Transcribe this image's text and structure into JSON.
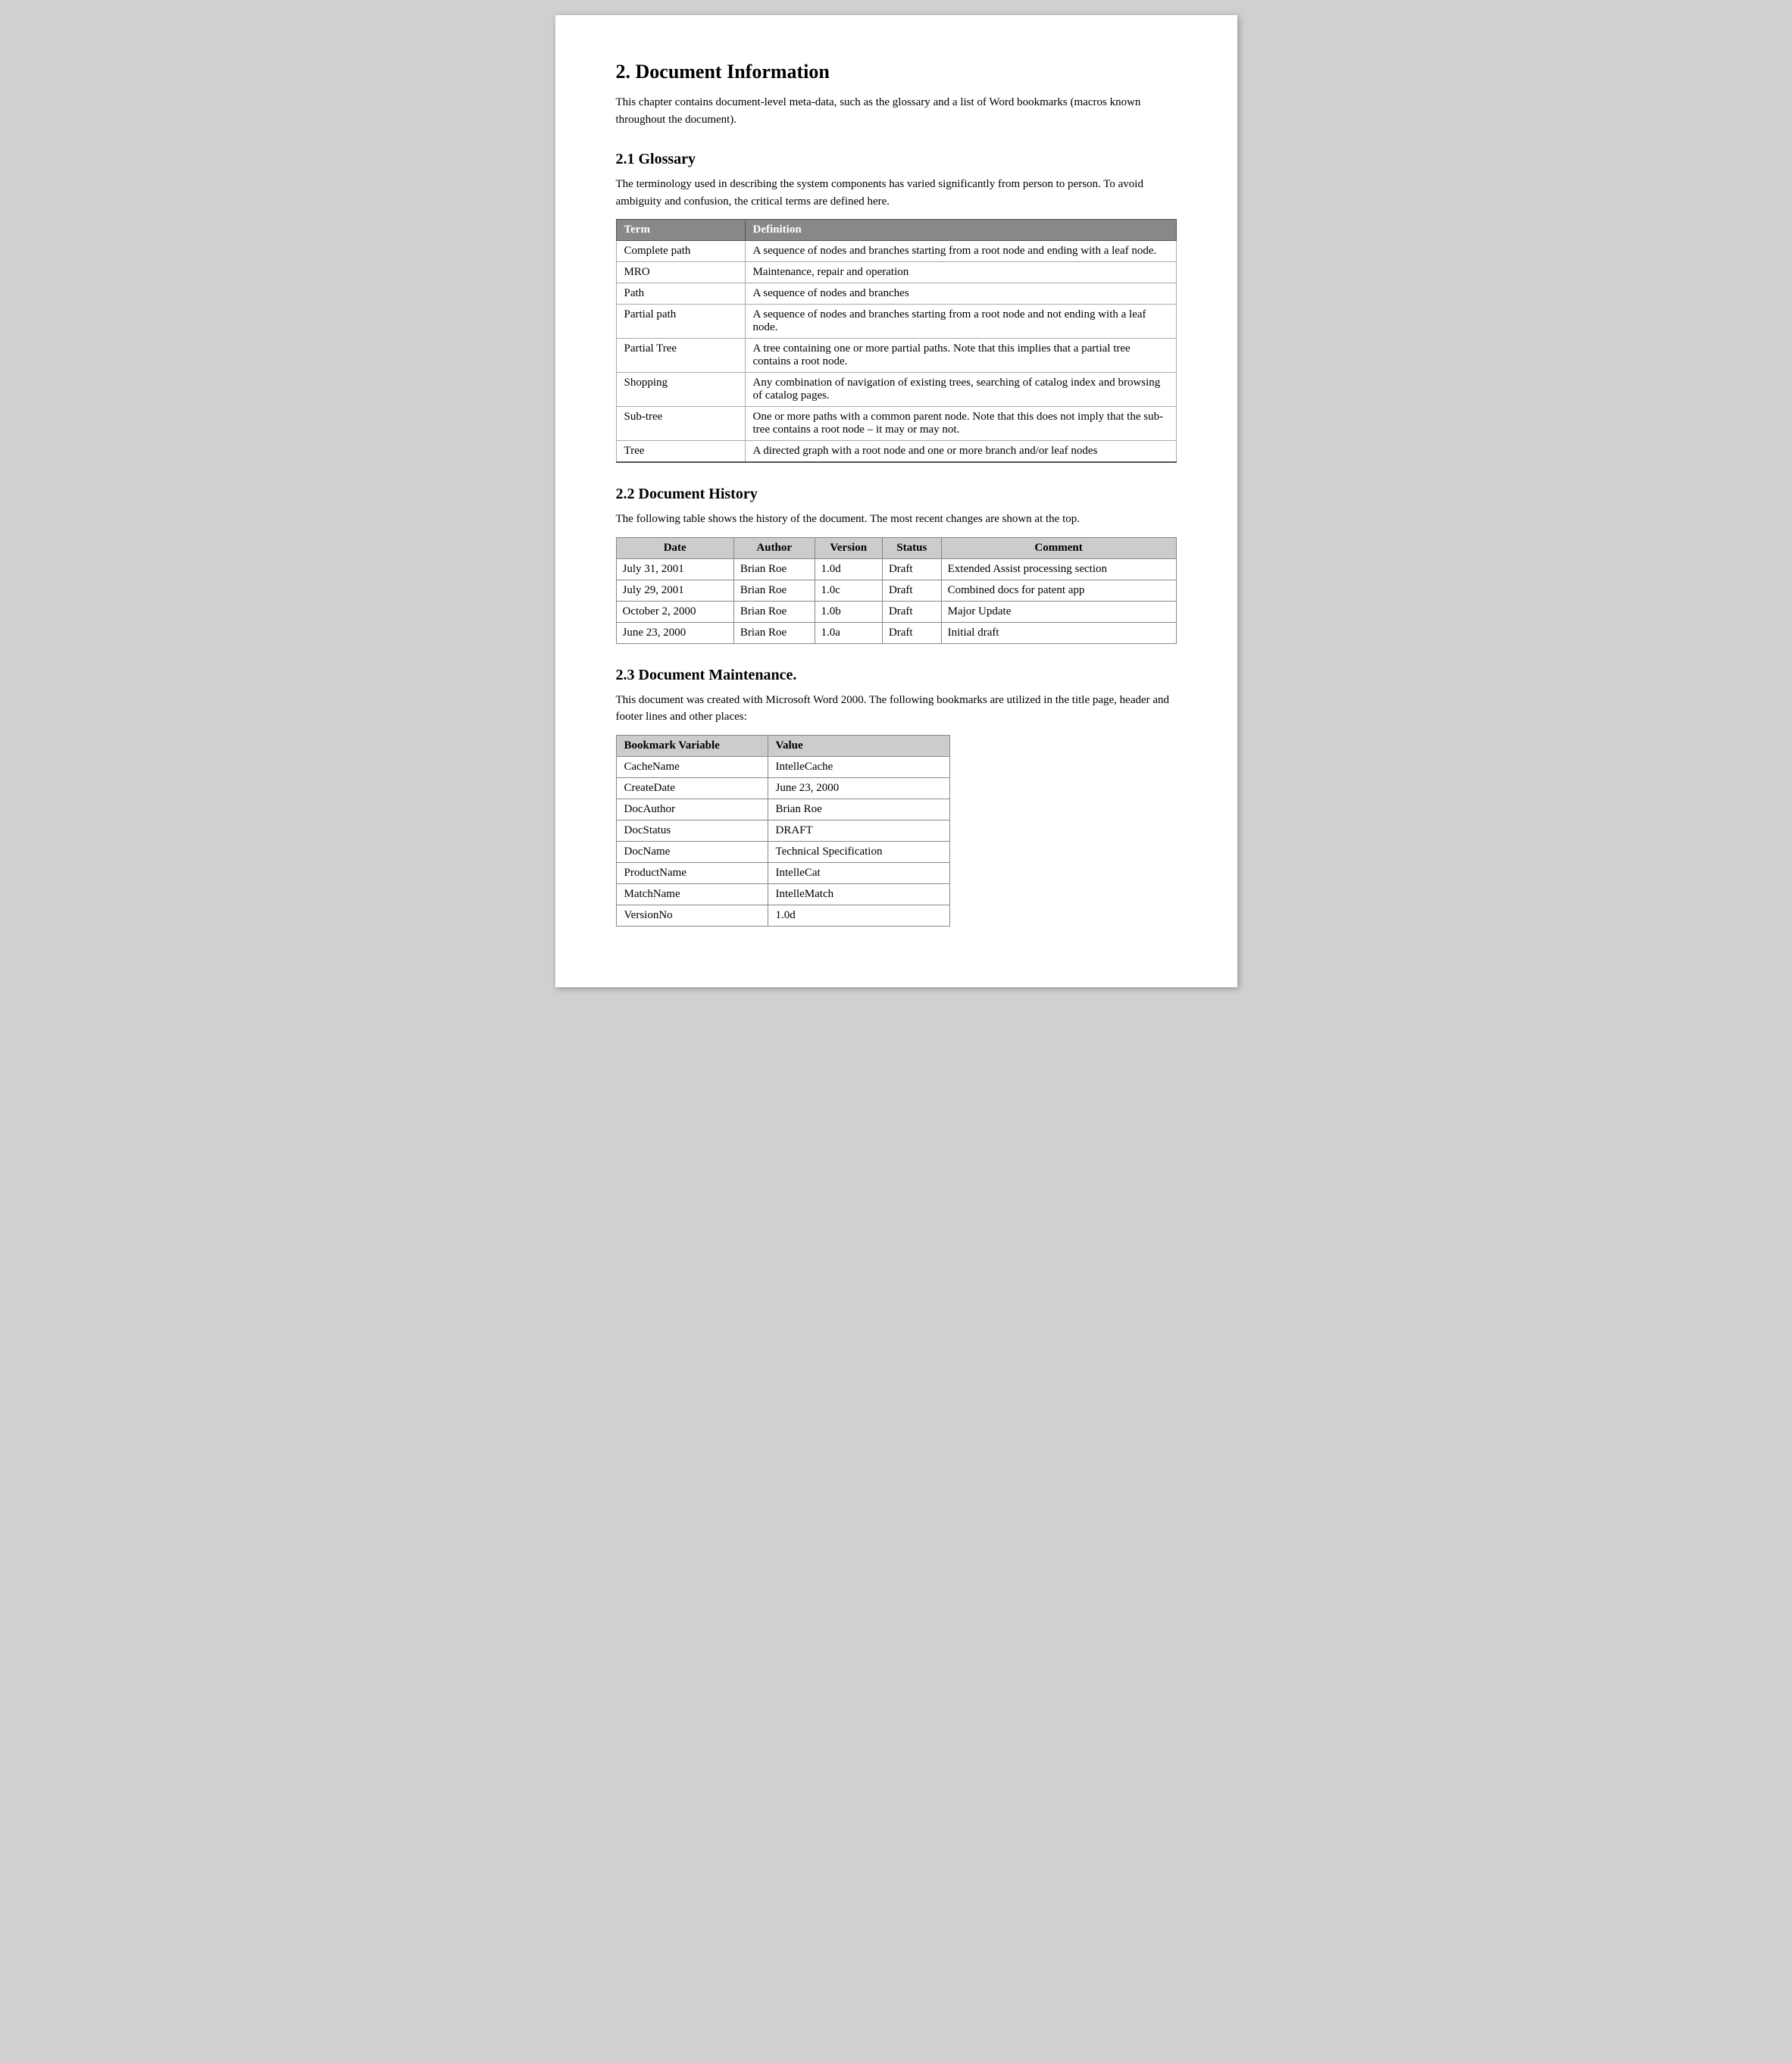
{
  "page": {
    "section2": {
      "title": "2.   Document Information",
      "intro": "This chapter contains document-level meta-data, such as the glossary and a list of Word bookmarks (macros known throughout the document)."
    },
    "section2_1": {
      "title": "2.1  Glossary",
      "intro": "The terminology used in describing the system components has varied significantly from person to person.  To avoid ambiguity and confusion, the critical terms are defined here.",
      "table": {
        "headers": [
          "Term",
          "Definition"
        ],
        "rows": [
          [
            "Complete path",
            "A sequence of nodes and branches starting from a root node and ending with a leaf node."
          ],
          [
            "MRO",
            "Maintenance, repair and operation"
          ],
          [
            "Path",
            "A sequence of nodes and branches"
          ],
          [
            "Partial path",
            "A sequence of nodes and branches starting from a root node and not ending with a leaf node."
          ],
          [
            "Partial Tree",
            "A tree containing one or more partial paths.  Note that this implies that a partial tree contains a root node."
          ],
          [
            "Shopping",
            "Any combination of navigation of existing trees, searching of catalog index and browsing of catalog pages."
          ],
          [
            "Sub-tree",
            "One or more paths with a common parent node.  Note that this does not imply that the sub-tree contains a root node – it may or may not."
          ],
          [
            "Tree",
            "A directed graph with a root node and one or more branch and/or leaf nodes"
          ]
        ]
      }
    },
    "section2_2": {
      "title": "2.2  Document History",
      "intro": "The following table shows the history of the document.  The most recent changes are shown at the top.",
      "table": {
        "headers": [
          "Date",
          "Author",
          "Version",
          "Status",
          "Comment"
        ],
        "rows": [
          [
            "July 31, 2001",
            "Brian Roe",
            "1.0d",
            "Draft",
            "Extended Assist processing section"
          ],
          [
            "July 29, 2001",
            "Brian Roe",
            "1.0c",
            "Draft",
            "Combined docs for patent app"
          ],
          [
            "October 2, 2000",
            "Brian Roe",
            "1.0b",
            "Draft",
            "Major Update"
          ],
          [
            "June 23, 2000",
            "Brian Roe",
            "1.0a",
            "Draft",
            "Initial draft"
          ]
        ]
      }
    },
    "section2_3": {
      "title": "2.3  Document Maintenance.",
      "intro": "This document was created with Microsoft Word 2000. The following bookmarks are utilized in the title page, header and footer lines and other places:",
      "table": {
        "headers": [
          "Bookmark Variable",
          "Value"
        ],
        "rows": [
          [
            "CacheName",
            "IntelleCache"
          ],
          [
            "CreateDate",
            "June 23, 2000"
          ],
          [
            "DocAuthor",
            "Brian Roe"
          ],
          [
            "DocStatus",
            "DRAFT"
          ],
          [
            "DocName",
            "Technical Specification"
          ],
          [
            "ProductName",
            "IntelleCat"
          ],
          [
            "MatchName",
            "IntelleMatch"
          ],
          [
            "VersionNo",
            "1.0d"
          ]
        ]
      }
    }
  }
}
